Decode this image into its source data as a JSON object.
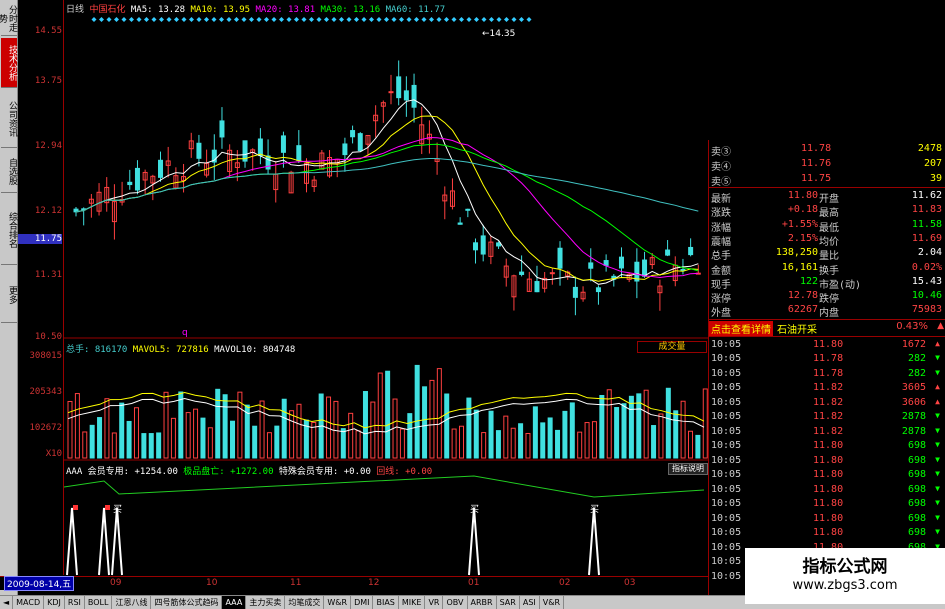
{
  "left_tabs": [
    "分时走势",
    "技术分析",
    "公司资讯",
    "自选股",
    "综合排名",
    "更多"
  ],
  "active_left_tab": 1,
  "title": {
    "period": "日线",
    "name": "中国石化",
    "ma5": "MA5: 13.28",
    "ma10": "MA10: 13.95",
    "ma20": "MA20: 13.81",
    "ma30": "MA30: 13.16",
    "ma60": "MA60: 11.77"
  },
  "price_axis": [
    "14.55",
    "13.75",
    "12.94",
    "12.12",
    "11.75",
    "11.31",
    "10.50"
  ],
  "price_axis_current": "11.75",
  "peak_label": "14.35",
  "low_label": "q",
  "vol_axis": [
    "308015",
    "205343",
    "102672",
    "X10"
  ],
  "vol_info": {
    "total": "总手: 816170",
    "mavol5": "MAVOL5: 727816",
    "mavol10": "MAVOL10: 804748"
  },
  "vol_button": "成交量",
  "aaa_info": {
    "name": "AAA 会员专用:",
    "v1": "+1254.00",
    "n2": "极品盘亡:",
    "v2": "+1272.00",
    "n3": "特殊会员专用:",
    "v3": "+0.00",
    "n4": "回线:",
    "v4": "+0.00"
  },
  "help_button": "指标说明",
  "signal_label": "买",
  "date_box": "2009-08-14,五",
  "date_labels": [
    "09",
    "10",
    "11",
    "12",
    "01",
    "02",
    "03"
  ],
  "bottom_tabs": [
    "MACD",
    "KDJ",
    "RSI",
    "BOLL",
    "江恩八线",
    "四号筋体公式趋码",
    "AAA",
    "主力买卖",
    "均笔成交",
    "W&R",
    "DMI",
    "BIAS",
    "MIKE",
    "VR",
    "OBV",
    "ARBR",
    "SAR",
    "ASI",
    "V&R"
  ],
  "active_bottom_tab": 6,
  "quote": {
    "asks": [
      {
        "l": "卖③",
        "p": "11.78",
        "v": "2478"
      },
      {
        "l": "卖④",
        "p": "11.76",
        "v": "207"
      },
      {
        "l": "卖⑤",
        "p": "11.75",
        "v": "39"
      }
    ],
    "stats": [
      {
        "l": "最新",
        "v": "11.80",
        "l2": "开盘",
        "v2": "11.62"
      },
      {
        "l": "涨跌",
        "v": "+0.18",
        "l2": "最高",
        "v2": "11.83"
      },
      {
        "l": "涨幅",
        "v": "+1.55%",
        "l2": "最低",
        "v2": "11.58"
      },
      {
        "l": "震幅",
        "v": "2.15%",
        "l2": "均价",
        "v2": "11.69"
      },
      {
        "l": "总手",
        "v": "138,250",
        "l2": "量比",
        "v2": "2.04"
      },
      {
        "l": "金额",
        "v": "16,161",
        "l2": "换手",
        "v2": "0.02%"
      },
      {
        "l": "现手",
        "v": "122",
        "l2": "市盈(动)",
        "v2": "15.43"
      },
      {
        "l": "涨停",
        "v": "12.78",
        "l2": "跌停",
        "v2": "10.46"
      },
      {
        "l": "外盘",
        "v": "62267",
        "l2": "内盘",
        "v2": "75983"
      }
    ],
    "detail_button": "点击查看详情",
    "sector": "石油开采",
    "sector_pct": "0.43%",
    "ticks": [
      {
        "t": "10:05",
        "p": "11.80",
        "v": "1672"
      },
      {
        "t": "10:05",
        "p": "11.78",
        "v": "282"
      },
      {
        "t": "10:05",
        "p": "11.78",
        "v": "282"
      },
      {
        "t": "10:05",
        "p": "11.82",
        "v": "3605"
      },
      {
        "t": "10:05",
        "p": "11.82",
        "v": "3606"
      },
      {
        "t": "10:05",
        "p": "11.82",
        "v": "2878"
      },
      {
        "t": "10:05",
        "p": "11.82",
        "v": "2878"
      },
      {
        "t": "10:05",
        "p": "11.80",
        "v": "698"
      },
      {
        "t": "10:05",
        "p": "11.80",
        "v": "698"
      },
      {
        "t": "10:05",
        "p": "11.80",
        "v": "698"
      },
      {
        "t": "10:05",
        "p": "11.80",
        "v": "698"
      },
      {
        "t": "10:05",
        "p": "11.80",
        "v": "698"
      },
      {
        "t": "10:05",
        "p": "11.80",
        "v": "698"
      },
      {
        "t": "10:05",
        "p": "11.80",
        "v": "698"
      },
      {
        "t": "10:05",
        "p": "11.80",
        "v": "698"
      },
      {
        "t": "10:05",
        "p": "11.80",
        "v": "698"
      },
      {
        "t": "10:05",
        "p": "11.80",
        "v": "698"
      }
    ]
  },
  "watermark": {
    "title": "指标公式网",
    "url": "www.zbgs3.com"
  },
  "colors": {
    "up": "#ff4040",
    "down": "#40e0e0",
    "ma5": "#ffffff",
    "ma10": "#ffff00",
    "ma20": "#ff00ff",
    "ma30": "#00ff00",
    "ma60": "#40c0c0"
  }
}
